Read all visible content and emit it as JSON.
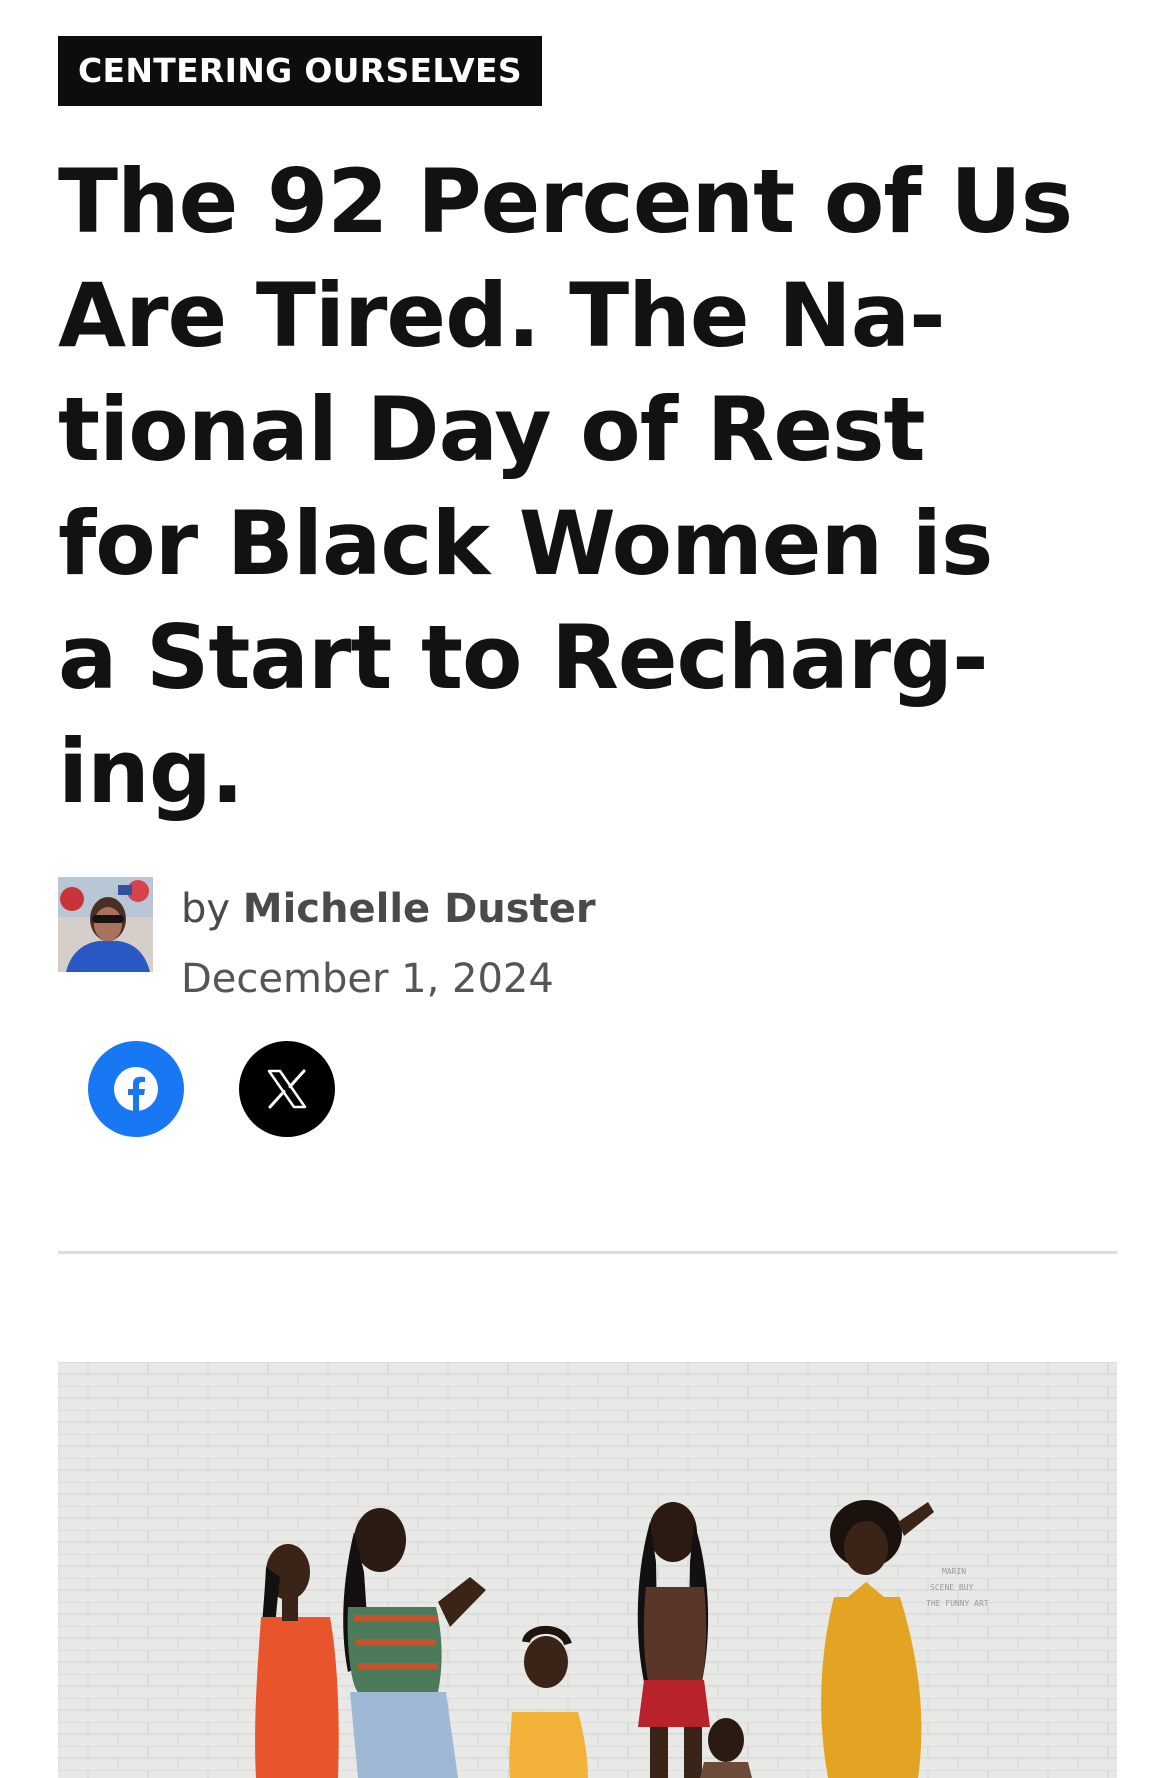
{
  "article": {
    "category": "CENTERING OURSELVES",
    "headline_lines": [
      "The 92 Percent of Us",
      "Are Tired. The Na-",
      "tional Day of Rest",
      "for Black Women is",
      "a Start to Recharg-",
      "ing."
    ],
    "byline_prefix": "by",
    "author": "Michelle Duster",
    "date": "December 1, 2024"
  },
  "share": {
    "facebook_icon": "facebook-icon",
    "twitter_icon": "x-icon"
  },
  "hero_image": {
    "wall_note_lines": [
      "MARIN",
      "SCENE BUY",
      "THE FUNNY ART"
    ]
  },
  "colors": {
    "category_bg": "#0d0d0d",
    "facebook_blue": "#1877f2",
    "x_black": "#000000",
    "divider": "#dddddd"
  }
}
